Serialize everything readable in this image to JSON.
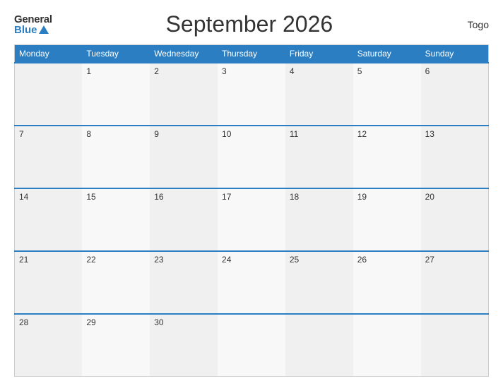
{
  "logo": {
    "general": "General",
    "blue": "Blue"
  },
  "title": "September 2026",
  "country": "Togo",
  "days_header": [
    "Monday",
    "Tuesday",
    "Wednesday",
    "Thursday",
    "Friday",
    "Saturday",
    "Sunday"
  ],
  "weeks": [
    [
      "",
      "1",
      "2",
      "3",
      "4",
      "5",
      "6"
    ],
    [
      "7",
      "8",
      "9",
      "10",
      "11",
      "12",
      "13"
    ],
    [
      "14",
      "15",
      "16",
      "17",
      "18",
      "19",
      "20"
    ],
    [
      "21",
      "22",
      "23",
      "24",
      "25",
      "26",
      "27"
    ],
    [
      "28",
      "29",
      "30",
      "",
      "",
      "",
      ""
    ]
  ]
}
